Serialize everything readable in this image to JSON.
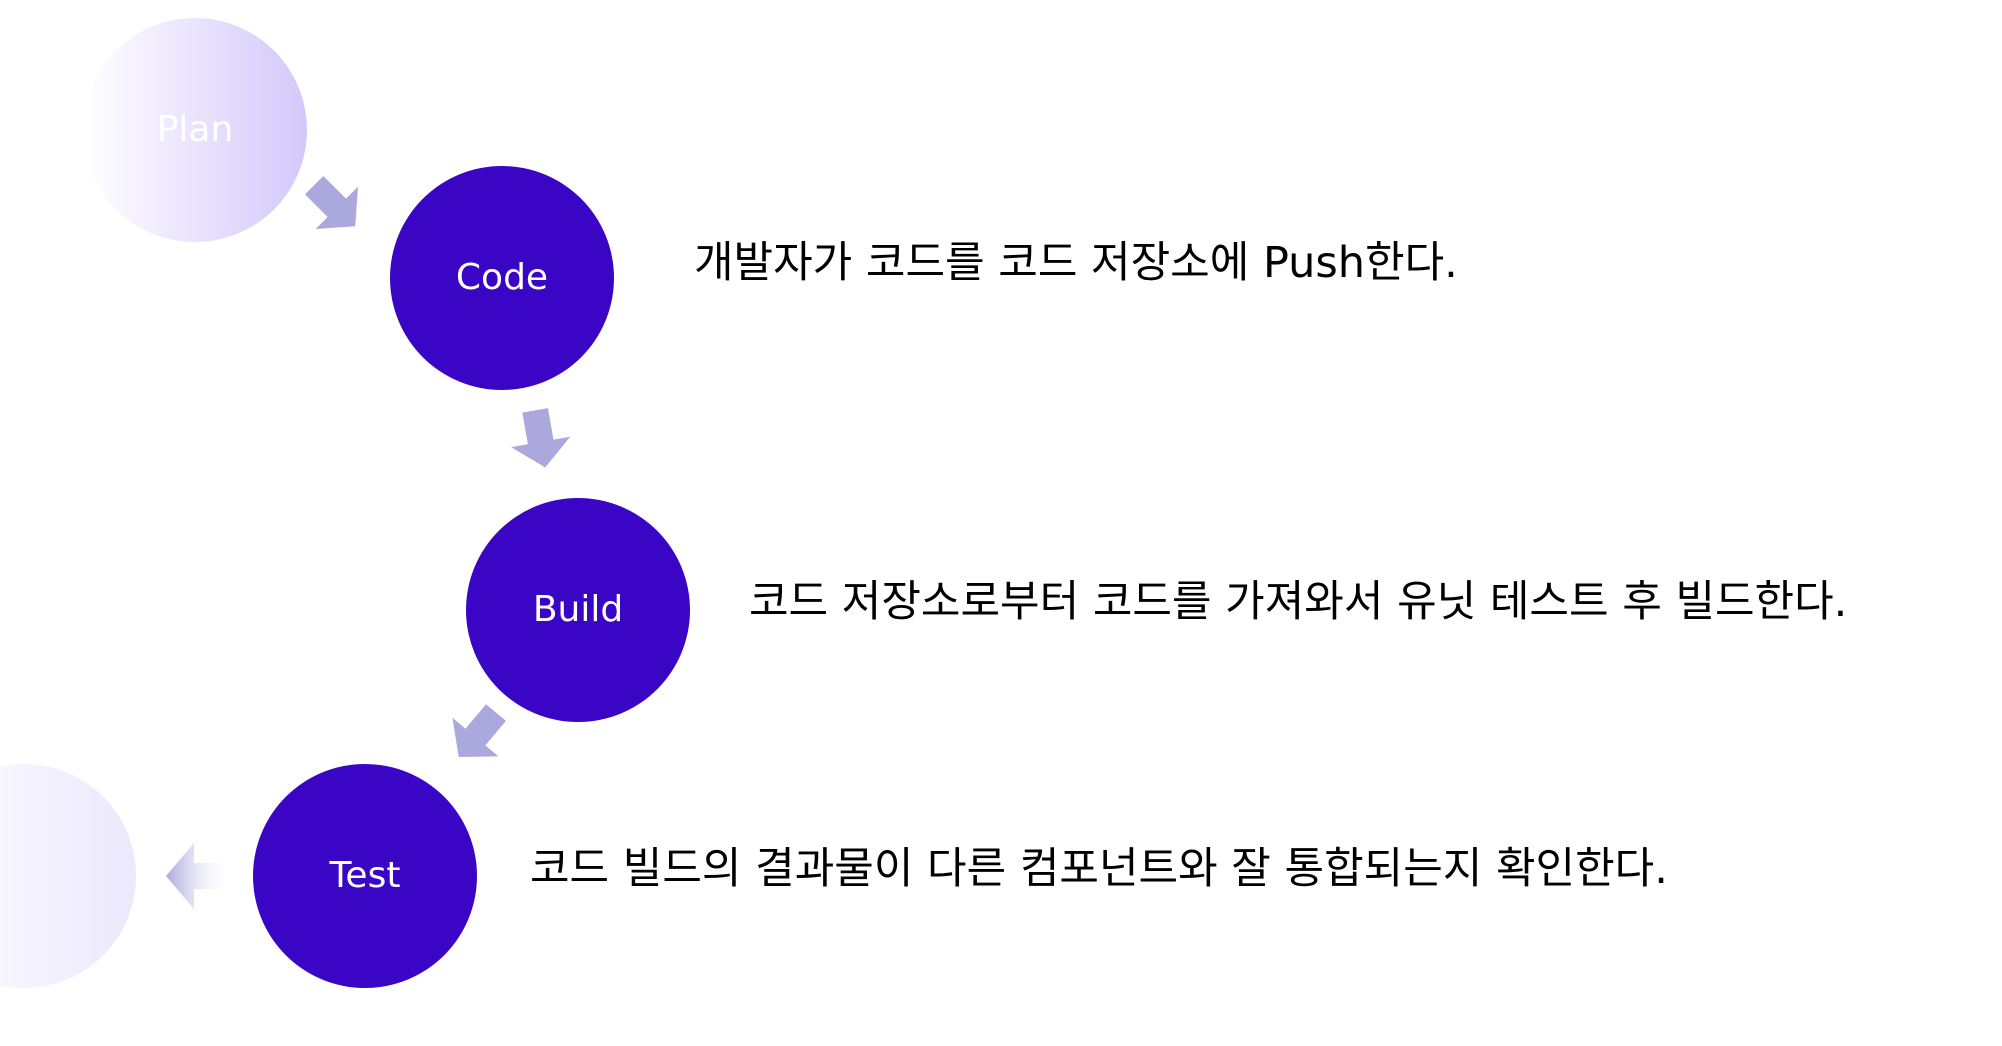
{
  "colors": {
    "node_fill": "#3a05c5",
    "node_text": "#ffffff",
    "arrow": "#aaa8dc",
    "faded_node_light": "#ffffff",
    "faded_node_dark": "#d4c8fb",
    "text": "#000000"
  },
  "steps": [
    {
      "label": "Plan",
      "description": ""
    },
    {
      "label": "Code",
      "description": "개발자가 코드를 코드 저장소에 Push한다."
    },
    {
      "label": "Build",
      "description": "코드 저장소로부터 코드를 가져와서 유닛 테스트 후 빌드한다."
    },
    {
      "label": "Test",
      "description": "코드 빌드의 결과물이 다른 컴포넌트와 잘 통합되는지 확인한다."
    }
  ],
  "icons": {
    "flow_arrow": "arrow-icon",
    "back_arrow": "left-arrow-icon"
  }
}
